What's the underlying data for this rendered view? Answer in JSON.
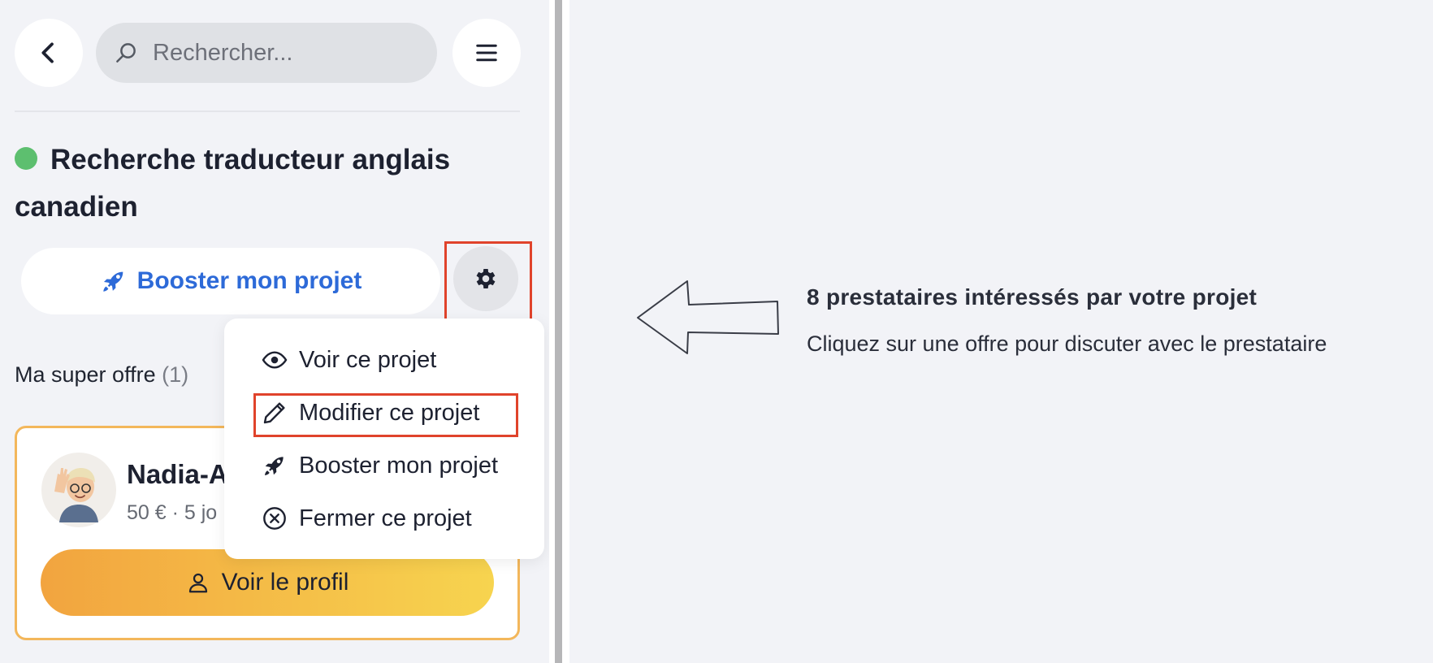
{
  "search": {
    "placeholder": "Rechercher..."
  },
  "project": {
    "status_color": "#5dbf6f",
    "title": "Recherche traducteur anglais canadien",
    "boost_label": "Booster mon projet"
  },
  "offers": {
    "heading": "Ma super offre",
    "count": "(1)",
    "card": {
      "name": "Nadia-A",
      "meta": "50 € · 5 jo",
      "profile_button": "Voir le profil"
    }
  },
  "dropdown": {
    "items": [
      {
        "label": "Voir ce projet",
        "icon": "eye-icon"
      },
      {
        "label": "Modifier ce projet",
        "icon": "pencil-icon"
      },
      {
        "label": "Booster mon projet",
        "icon": "rocket-icon"
      },
      {
        "label": "Fermer ce projet",
        "icon": "close-circle-icon"
      }
    ]
  },
  "empty_state": {
    "title": "8 prestataires intéressés par votre projet",
    "subtitle": "Cliquez sur une offre pour discuter avec le prestataire"
  },
  "colors": {
    "accent_blue": "#2d6ad8",
    "highlight_red": "#e0432b",
    "gold_start": "#f2a43f",
    "gold_end": "#f7d44f"
  }
}
